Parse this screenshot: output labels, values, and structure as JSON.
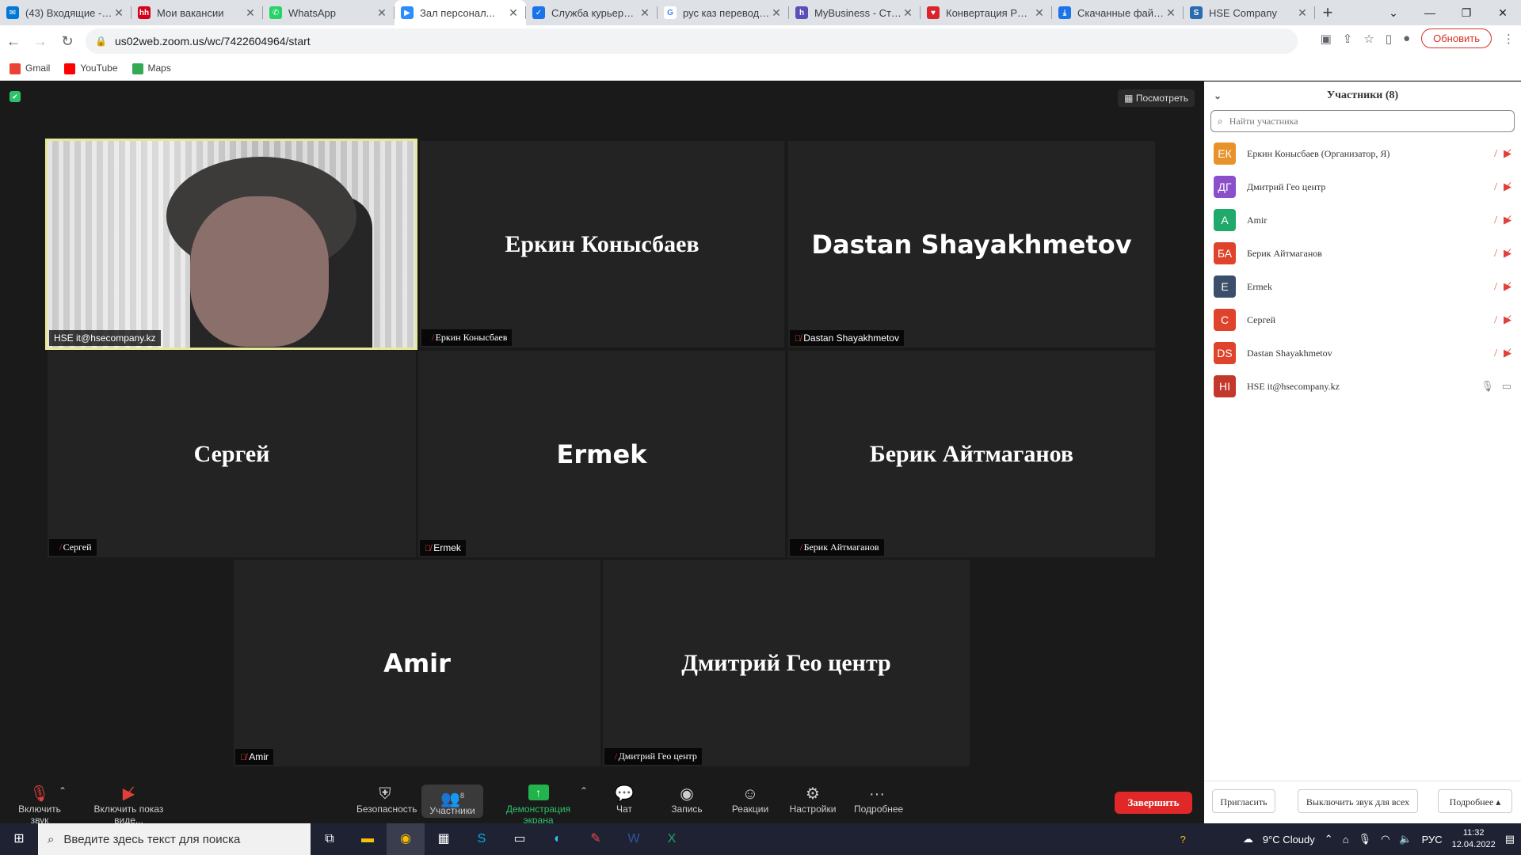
{
  "browser": {
    "tabs": [
      {
        "title": "(43) Входящие - П...",
        "favicon_color": "#0078d4",
        "favicon_glyph": "✉",
        "active": false
      },
      {
        "title": "Мои вакансии",
        "favicon_color": "#d6001c",
        "favicon_glyph": "hh",
        "active": false
      },
      {
        "title": "WhatsApp",
        "favicon_color": "#25d366",
        "favicon_glyph": "✆",
        "active": false
      },
      {
        "title": "Зал персонал...",
        "favicon_color": "#2d8cff",
        "favicon_glyph": "▶",
        "active": true
      },
      {
        "title": "Служба курьерск...",
        "favicon_color": "#1a73e8",
        "favicon_glyph": "✓",
        "active": false
      },
      {
        "title": "рус каз переводч...",
        "favicon_color": "#ffffff",
        "favicon_glyph": "G",
        "active": false
      },
      {
        "title": "MyBusiness - Стат...",
        "favicon_color": "#5a4fb6",
        "favicon_glyph": "h",
        "active": false
      },
      {
        "title": "Конвертация PDF...",
        "favicon_color": "#d9242b",
        "favicon_glyph": "♥",
        "active": false
      },
      {
        "title": "Скачанные файлы",
        "favicon_color": "#1a73e8",
        "favicon_glyph": "⤓",
        "active": false
      },
      {
        "title": "HSE Company",
        "favicon_color": "#2b6cb0",
        "favicon_glyph": "S",
        "active": false
      }
    ],
    "url": "us02web.zoom.us/wc/7422604964/start",
    "update_label": "Обновить",
    "bookmarks": [
      {
        "label": "Gmail",
        "color": "#ea4335"
      },
      {
        "label": "YouTube",
        "color": "#ff0000"
      },
      {
        "label": "Maps",
        "color": "#34a853"
      }
    ]
  },
  "meeting": {
    "view_label": "Посмотреть",
    "tiles": [
      {
        "name": "HSE it@hsecompany.kz",
        "big": "",
        "video": true,
        "muted": false
      },
      {
        "name": "Еркин Конысбаев",
        "big": "Еркин Конысбаев",
        "muted": true
      },
      {
        "name": "Dastan Shayakhmetov",
        "big": "Dastan Shayakhmetov",
        "muted": true
      },
      {
        "name": "Сергей",
        "big": "Сергей",
        "muted": true
      },
      {
        "name": "Ermek",
        "big": "Ermek",
        "muted": true
      },
      {
        "name": "Берик Айтмаганов",
        "big": "Берик Айтмаганов",
        "muted": true
      },
      {
        "name": "Amir",
        "big": "Amir",
        "muted": true
      },
      {
        "name": "Дмитрий Гео центр",
        "big": "Дмитрий Гео центр",
        "muted": true
      }
    ],
    "toolbar": {
      "unmute": "Включить звук",
      "start_video": "Включить показ виде...",
      "security": "Безопасность",
      "participants": "Участники",
      "participants_count": "8",
      "share": "Демонстрация экрана",
      "chat": "Чат",
      "record": "Запись",
      "reactions": "Реакции",
      "settings": "Настройки",
      "more": "Подробнее",
      "end": "Завершить"
    }
  },
  "panel": {
    "title": "Участники (8)",
    "search_placeholder": "Найти участника",
    "participants": [
      {
        "initials": "ЕК",
        "name": "Еркин Конысбаев (Организатор, Я)",
        "color": "#e8922a",
        "muted": true
      },
      {
        "initials": "ДГ",
        "name": "Дмитрий Гео центр",
        "color": "#8b4fc9",
        "muted": true
      },
      {
        "initials": "A",
        "name": "Amir",
        "color": "#1faa6b",
        "muted": true
      },
      {
        "initials": "БА",
        "name": "Берик Айтмаганов",
        "color": "#e0432b",
        "muted": true
      },
      {
        "initials": "E",
        "name": "Ermek",
        "color": "#3b4e6a",
        "muted": true
      },
      {
        "initials": "С",
        "name": "Сергей",
        "color": "#e0432b",
        "muted": true
      },
      {
        "initials": "DS",
        "name": "Dastan Shayakhmetov",
        "color": "#e0432b",
        "muted": true
      },
      {
        "initials": "HI",
        "name": "HSE it@hsecompany.kz",
        "color": "#c4372c",
        "muted": false
      }
    ],
    "invite": "Пригласить",
    "mute_all": "Выключить звук для всех",
    "more": "Подробнее ▴"
  },
  "taskbar": {
    "search_placeholder": "Введите здесь текст для поиска",
    "weather": "9°C  Cloudy",
    "lang": "РУС",
    "time": "11:32",
    "date": "12.04.2022"
  }
}
